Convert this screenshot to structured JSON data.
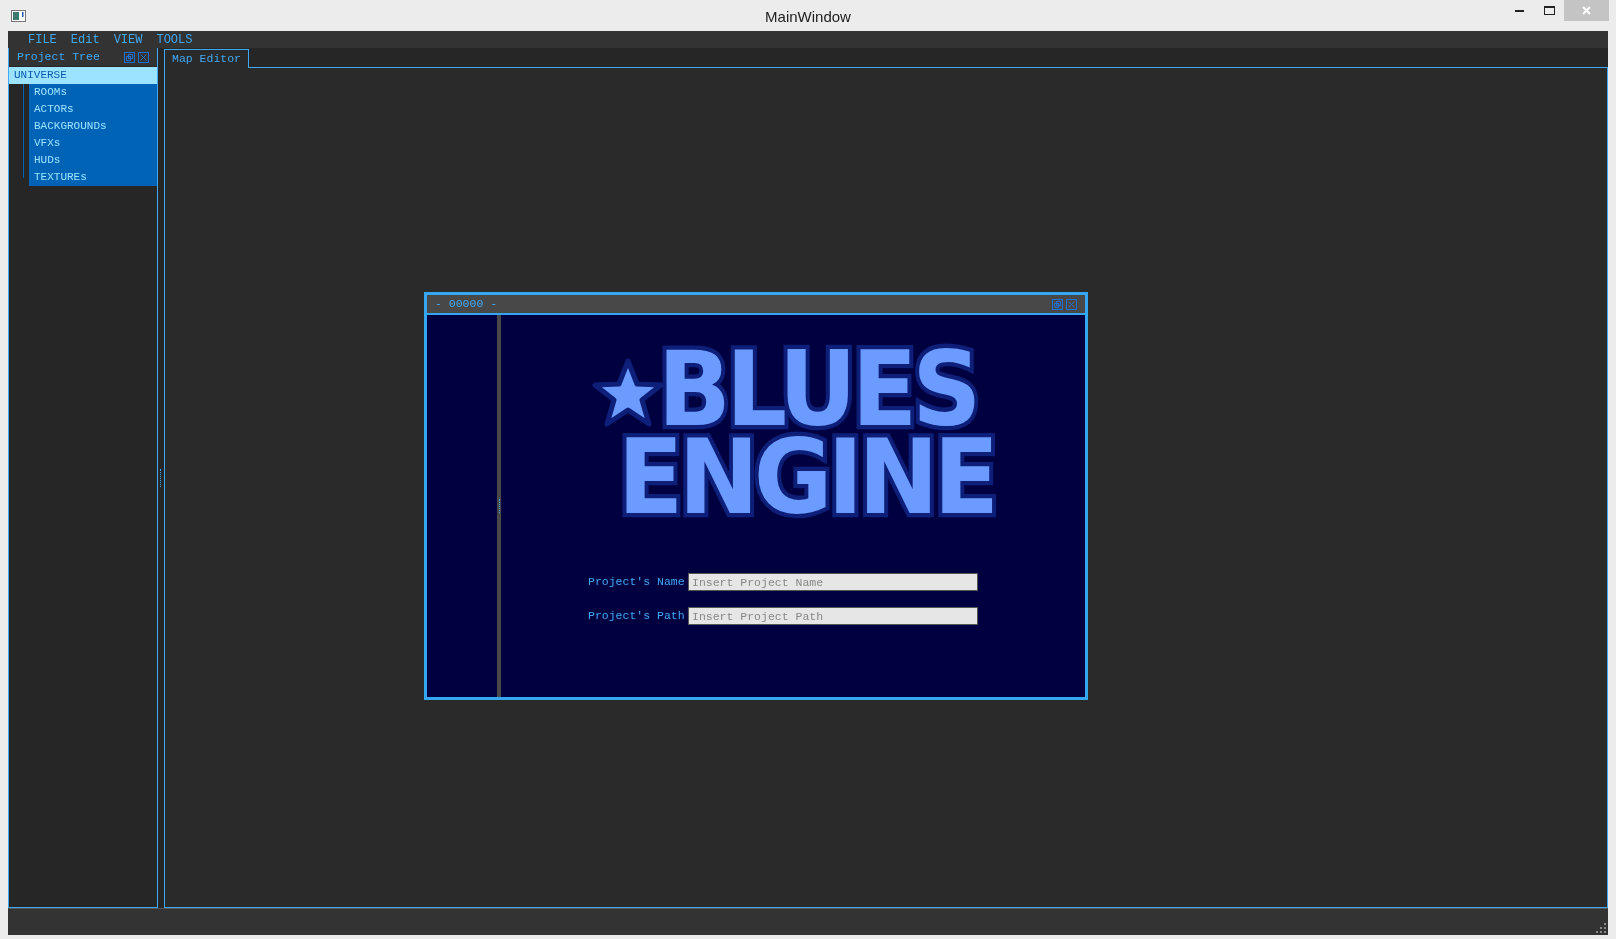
{
  "window": {
    "title": "MainWindow"
  },
  "menu": [
    "FILE",
    "Edit",
    "VIEW",
    "TOOLS"
  ],
  "project_tree": {
    "title": "Project Tree",
    "items": [
      {
        "label": "UNIVERSE",
        "selected": true,
        "children": [
          {
            "label": "ROOMs",
            "selected": false
          },
          {
            "label": "ACTORs",
            "selected": false
          },
          {
            "label": "BACKGROUNDs",
            "selected": false
          },
          {
            "label": "VFXs",
            "selected": false
          },
          {
            "label": "HUDs",
            "selected": false
          },
          {
            "label": "TEXTUREs",
            "selected": false
          }
        ]
      }
    ]
  },
  "tabs": [
    {
      "label": "Map Editor",
      "selected": true
    }
  ],
  "dialog": {
    "title": "- 00000 -",
    "logo": [
      "BLUES",
      "ENGINE"
    ],
    "fields": [
      {
        "label": "Project's Name",
        "placeholder": "Insert Project Name"
      },
      {
        "label": "Project's Path",
        "placeholder": "Insert Project Path"
      }
    ]
  }
}
